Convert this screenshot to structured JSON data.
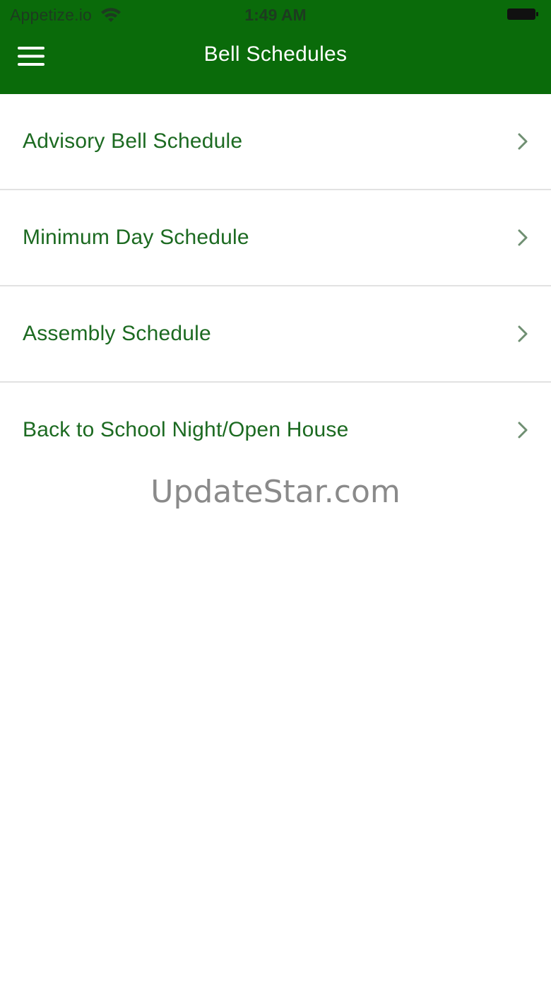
{
  "status_bar": {
    "carrier": "Appetize.io",
    "time": "1:49 AM",
    "wifi_icon": "wifi-icon",
    "battery_icon": "battery-icon"
  },
  "nav": {
    "title": "Bell Schedules",
    "menu_icon": "hamburger-menu-icon"
  },
  "schedules": [
    {
      "label": "Advisory Bell Schedule"
    },
    {
      "label": "Minimum Day Schedule"
    },
    {
      "label": "Assembly Schedule"
    },
    {
      "label": "Back to School Night/Open House"
    }
  ],
  "watermark": "UpdateStar.com",
  "colors": {
    "header_bg": "#0a6b0a",
    "item_text": "#1c6a21",
    "divider": "#e2e2e2",
    "chevron": "#6f8f72"
  }
}
